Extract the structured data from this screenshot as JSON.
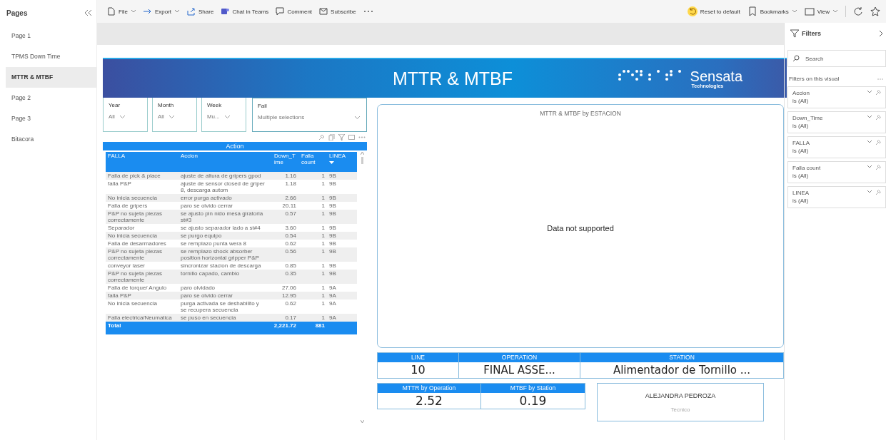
{
  "pages": {
    "title": "Pages",
    "items": [
      {
        "label": "Page 1",
        "selected": false
      },
      {
        "label": "TPMS Down Time",
        "selected": false
      },
      {
        "label": "MTTR & MTBF",
        "selected": true
      },
      {
        "label": "Page 2",
        "selected": false
      },
      {
        "label": "Page 3",
        "selected": false
      },
      {
        "label": "Bitacora",
        "selected": false
      }
    ]
  },
  "toolbar": {
    "left": [
      {
        "kind": "file",
        "label": "File",
        "dropdown": true
      },
      {
        "kind": "export",
        "label": "Export",
        "dropdown": true
      },
      {
        "kind": "share",
        "label": "Share",
        "dropdown": false
      },
      {
        "kind": "teams",
        "label": "Chat in Teams",
        "dropdown": false
      },
      {
        "kind": "comment",
        "label": "Comment",
        "dropdown": false
      },
      {
        "kind": "subscribe",
        "label": "Subscribe",
        "dropdown": false
      }
    ],
    "right": [
      {
        "kind": "reset",
        "label": "Reset to default",
        "dropdown": false
      },
      {
        "kind": "bookmark",
        "label": "Bookmarks",
        "dropdown": true
      },
      {
        "kind": "view",
        "label": "View",
        "dropdown": true
      }
    ]
  },
  "banner": {
    "title": "MTTR & MTBF",
    "logo": "Sensata",
    "logo_sub": "Technologies"
  },
  "slicers": [
    {
      "label": "Year",
      "value": "All"
    },
    {
      "label": "Month",
      "value": "All"
    },
    {
      "label": "Week",
      "value": "Mu..."
    },
    {
      "label": "Fail",
      "value": "Multiple selections"
    }
  ],
  "table": {
    "title": "Action",
    "columns": [
      "FALLA",
      "Accion",
      "Down_Time",
      "Falla count",
      "LINEA"
    ],
    "rows": [
      [
        "Falla de pick & place",
        "ajuste de altura de gripers gpod",
        "1.16",
        "1",
        "9B"
      ],
      [
        "falla P&P",
        "ajuste de sensor closed de griper 8, descarga autom",
        "1.18",
        "1",
        "9B"
      ],
      [
        "No inicia secuencia",
        "error purga activado",
        "2.66",
        "1",
        "9B"
      ],
      [
        "Falla de gripers",
        "paro se olvido cerrar",
        "20.11",
        "1",
        "9B"
      ],
      [
        "P&P no sujeta piezas correctamente",
        "se ajusto pin nido mesa giratoria st#3",
        "0.57",
        "1",
        "9B"
      ],
      [
        "Separador",
        "se ajusto separador lado a st#4",
        "3.60",
        "1",
        "9B"
      ],
      [
        "No inicia secuencia",
        "se purgo equipo",
        "0.54",
        "1",
        "9B"
      ],
      [
        "Falla de desarmadores",
        "se remplazo punta wera 8",
        "0.62",
        "1",
        "9B"
      ],
      [
        "P&P no sujeta piezas correctamente",
        "se remplazo shock absorber position horizontal gripper P&P",
        "0.56",
        "1",
        "9B"
      ],
      [
        "conveyor laser",
        "sincronizar stacion de descarga",
        "0.85",
        "1",
        "9B"
      ],
      [
        "P&P no sujeta piezas correctamente",
        "tornillo capado, cambio",
        "0.35",
        "1",
        "9B"
      ],
      [
        "Falla de torque/ Angulo",
        "paro olvidado",
        "27.06",
        "1",
        "9A"
      ],
      [
        "falla P&P",
        "paro se olvido cerrar",
        "12.95",
        "1",
        "9A"
      ],
      [
        "No inicia secuencia",
        "purga activada se deshabilito y se recupera secuencia",
        "0.62",
        "1",
        "9A"
      ],
      [
        "Falla electrica/Neumatica",
        "se puso en secuencia",
        "0.17",
        "1",
        "9A"
      ]
    ],
    "total": {
      "label": "Total",
      "down_time": "2,221.72",
      "count": "881"
    }
  },
  "chart": {
    "title": "MTTR & MTBF by ESTACION",
    "message": "Data not supported"
  },
  "cards_top": [
    {
      "label": "LINE",
      "value": "10"
    },
    {
      "label": "OPERATION",
      "value": "FINAL ASSE..."
    },
    {
      "label": "STATION",
      "value": "Alimentador de Tornillo ..."
    }
  ],
  "cards_bottom": [
    {
      "label": "MTTR by Operation",
      "value": "2.52"
    },
    {
      "label": "MTBF  by Station",
      "value": "0.19"
    }
  ],
  "person": {
    "name": "ALEJANDRA PEDROZA",
    "role": "Tecnico"
  },
  "filters": {
    "title": "Filters",
    "search_placeholder": "Search",
    "section": "Filters on this visual",
    "items": [
      {
        "field": "Accion",
        "condition": "is (All)"
      },
      {
        "field": "Down_Time",
        "condition": "is (All)"
      },
      {
        "field": "FALLA",
        "condition": "is (All)"
      },
      {
        "field": "Falla count",
        "condition": "is (All)"
      },
      {
        "field": "LINEA",
        "condition": "is (All)"
      }
    ]
  }
}
